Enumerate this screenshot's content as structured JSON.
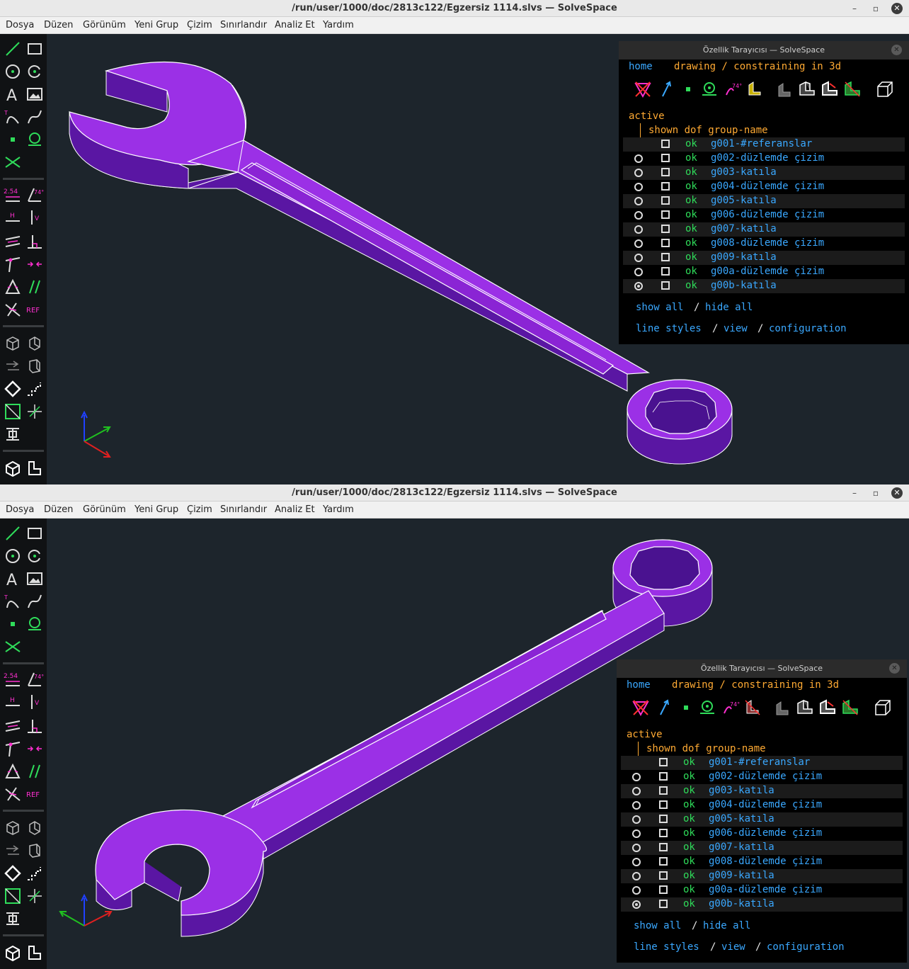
{
  "window": {
    "title": "/run/user/1000/doc/2813c122/Egzersiz 1114.slvs — SolveSpace",
    "controls": {
      "minimize": "–",
      "restore": "▫",
      "close": "✕"
    }
  },
  "menu": [
    "Dosya",
    "Düzen",
    "Görünüm",
    "Yeni Grup",
    "Çizim",
    "Sınırlandır",
    "Analiz Et",
    "Yardım"
  ],
  "toolbar": {
    "dimension_label": "2.54",
    "angle_label": "74°",
    "horizontal_label": "H",
    "vertical_label": "V",
    "reference_label": "REF",
    "icons": [
      "line-icon",
      "rectangle-icon",
      "circle-icon",
      "arc-icon",
      "text-icon",
      "image-icon",
      "tangent-arc-icon",
      "spline-icon",
      "point-icon",
      "workplane-icon",
      "split-curves-icon",
      "distance-icon",
      "angle-icon",
      "horizontal-icon",
      "vertical-icon",
      "parallel-icon",
      "perpendicular-icon",
      "point-on-line-icon",
      "symmetric-icon",
      "equal-icon",
      "same-orientation-icon",
      "other-supplementary-icon",
      "reference-icon",
      "nearest-iso-icon",
      "nearest-ortho-icon",
      "step-translate-icon",
      "step-rotate-icon",
      "extrude-icon",
      "workplane-group-icon",
      "revolve-icon",
      "helix-icon",
      "lathe-icon",
      "link-icon",
      "in-3d-icon",
      "in-workplane-icon"
    ]
  },
  "browser": {
    "title": "Özellik Tarayıcısı — SolveSpace",
    "close": "✕",
    "nav_home": "home",
    "nav_drawing": "drawing / constraining in 3d",
    "active_label": "active",
    "header": "shown dof group-name",
    "angle_badge": "74°",
    "groups": [
      {
        "name": "g001-#referanslar",
        "dof": "ok",
        "radio": "none"
      },
      {
        "name": "g002-düzlemde çizim",
        "dof": "ok",
        "radio": "empty"
      },
      {
        "name": "g003-katıla",
        "dof": "ok",
        "radio": "empty"
      },
      {
        "name": "g004-düzlemde çizim",
        "dof": "ok",
        "radio": "empty"
      },
      {
        "name": "g005-katıla",
        "dof": "ok",
        "radio": "empty"
      },
      {
        "name": "g006-düzlemde çizim",
        "dof": "ok",
        "radio": "empty"
      },
      {
        "name": "g007-katıla",
        "dof": "ok",
        "radio": "empty"
      },
      {
        "name": "g008-düzlemde çizim",
        "dof": "ok",
        "radio": "empty"
      },
      {
        "name": "g009-katıla",
        "dof": "ok",
        "radio": "empty"
      },
      {
        "name": "g00a-düzlemde çizim",
        "dof": "ok",
        "radio": "empty"
      },
      {
        "name": "g00b-katıla",
        "dof": "ok",
        "radio": "selected"
      }
    ],
    "show_all": "show all",
    "slash": "/",
    "hide_all": "hide all",
    "line_styles": "line styles",
    "view": "view",
    "configuration": "configuration"
  },
  "colors": {
    "solid": "#9b30e6",
    "solid_dark": "#5a16a3",
    "edge": "#ffffff",
    "background": "#1d252c"
  }
}
